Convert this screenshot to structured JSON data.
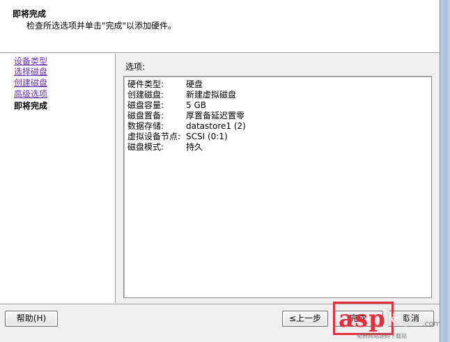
{
  "header": {
    "title": "即将完成",
    "description": "检查所选选项并单击\"完成\"以添加硬件。"
  },
  "steps": [
    {
      "label": "设备类型",
      "state": "link"
    },
    {
      "label": "选择磁盘",
      "state": "link"
    },
    {
      "label": "创建磁盘",
      "state": "link"
    },
    {
      "label": "高级选项",
      "state": "link"
    },
    {
      "label": "即将完成",
      "state": "current"
    }
  ],
  "options": {
    "label": "选项:",
    "rows": [
      {
        "key": "硬件类型:",
        "value": "硬盘"
      },
      {
        "key": "创建磁盘:",
        "value": "新建虚拟磁盘"
      },
      {
        "key": "磁盘容量:",
        "value": "5 GB"
      },
      {
        "key": "磁盘置备:",
        "value": "厚置备延迟置零"
      },
      {
        "key": "数据存储:",
        "value": "datastore1 (2)"
      },
      {
        "key": "虚拟设备节点:",
        "value": "SCSI (0:1)"
      },
      {
        "key": "磁盘模式:",
        "value": "持久"
      }
    ]
  },
  "buttons": {
    "help": "帮助(H)",
    "back": "≤上一步",
    "finish": "完成",
    "cancel": "取消"
  },
  "watermark": {
    "brand": "asp",
    "brand_suffix": "ku",
    "domain_suffix": ".com",
    "slogan": "免费网站源码下载站"
  },
  "colors": {
    "link": "#6b2fb3",
    "watermark_red": "#e52d3c"
  }
}
